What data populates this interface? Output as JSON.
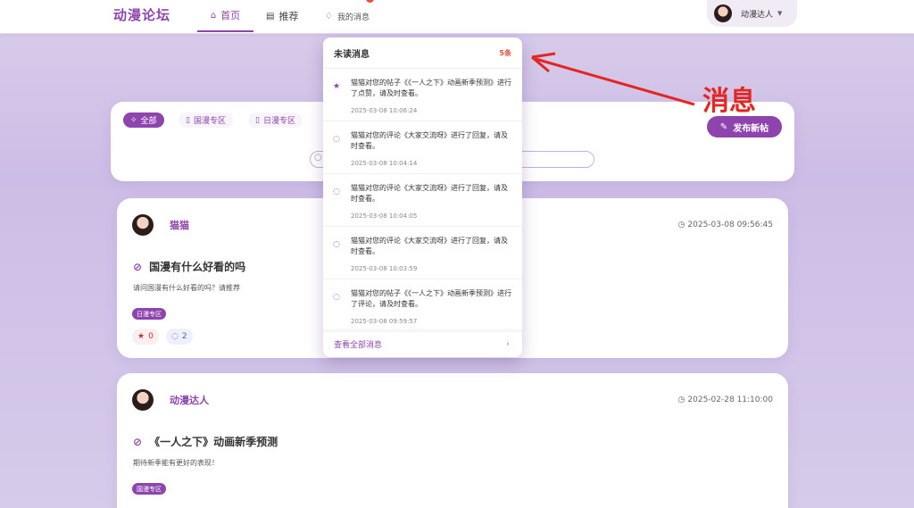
{
  "header": {
    "logo": "动漫论坛",
    "nav": [
      {
        "label": "首页",
        "icon": "home-icon"
      },
      {
        "label": "推荐",
        "icon": "briefcase-icon"
      },
      {
        "label": "我的消息",
        "icon": "bell-icon"
      }
    ],
    "user": {
      "name": "动漫达人",
      "icon": "caret-down-icon"
    }
  },
  "filter": {
    "tabs": [
      {
        "label": "全部",
        "active": true
      },
      {
        "label": "国漫专区",
        "active": false
      },
      {
        "label": "日漫专区",
        "active": false
      }
    ],
    "post_button": "发布新帖"
  },
  "notifications": {
    "title": "未读消息",
    "count": "5条",
    "items": [
      {
        "text": "猫猫对您的帖子《《一人之下》动画新季预测》进行了点赞，请及时查看。",
        "time": "2025-03-08 10:06:24",
        "icon": "star-icon"
      },
      {
        "text": "猫猫对您的评论《大家交流呀》进行了回复，请及时查看。",
        "time": "2025-03-08 10:04:14",
        "icon": "comment-icon"
      },
      {
        "text": "猫猫对您的评论《大家交流呀》进行了回复，请及时查看。",
        "time": "2025-03-08 10:04:05",
        "icon": "comment-icon"
      },
      {
        "text": "猫猫对您的评论《大家交流呀》进行了回复，请及时查看。",
        "time": "2025-03-08 10:03:59",
        "icon": "comment-icon"
      },
      {
        "text": "猫猫对您的帖子《《一人之下》动画新季预测》进行了评论，请及时查看。",
        "time": "2025-03-08 09:59:57",
        "icon": "comment-icon"
      }
    ],
    "view_all": "查看全部消息"
  },
  "posts": [
    {
      "author": "猫猫",
      "time": "2025-03-08 09:56:45",
      "title": "国漫有什么好看的吗",
      "desc": "请问国漫有什么好看的吗？请推荐",
      "tag": "日漫专区",
      "likes": "0",
      "comments": "2"
    },
    {
      "author": "动漫达人",
      "time": "2025-02-28 11:10:00",
      "title": "《一人之下》动画新季预测",
      "desc": "期待新季能有更好的表现！",
      "tag": "国漫专区"
    }
  ],
  "annotation": "消息",
  "colors": {
    "accent": "#8e44ad",
    "danger": "#e74c3c",
    "annotation": "#e52521"
  }
}
